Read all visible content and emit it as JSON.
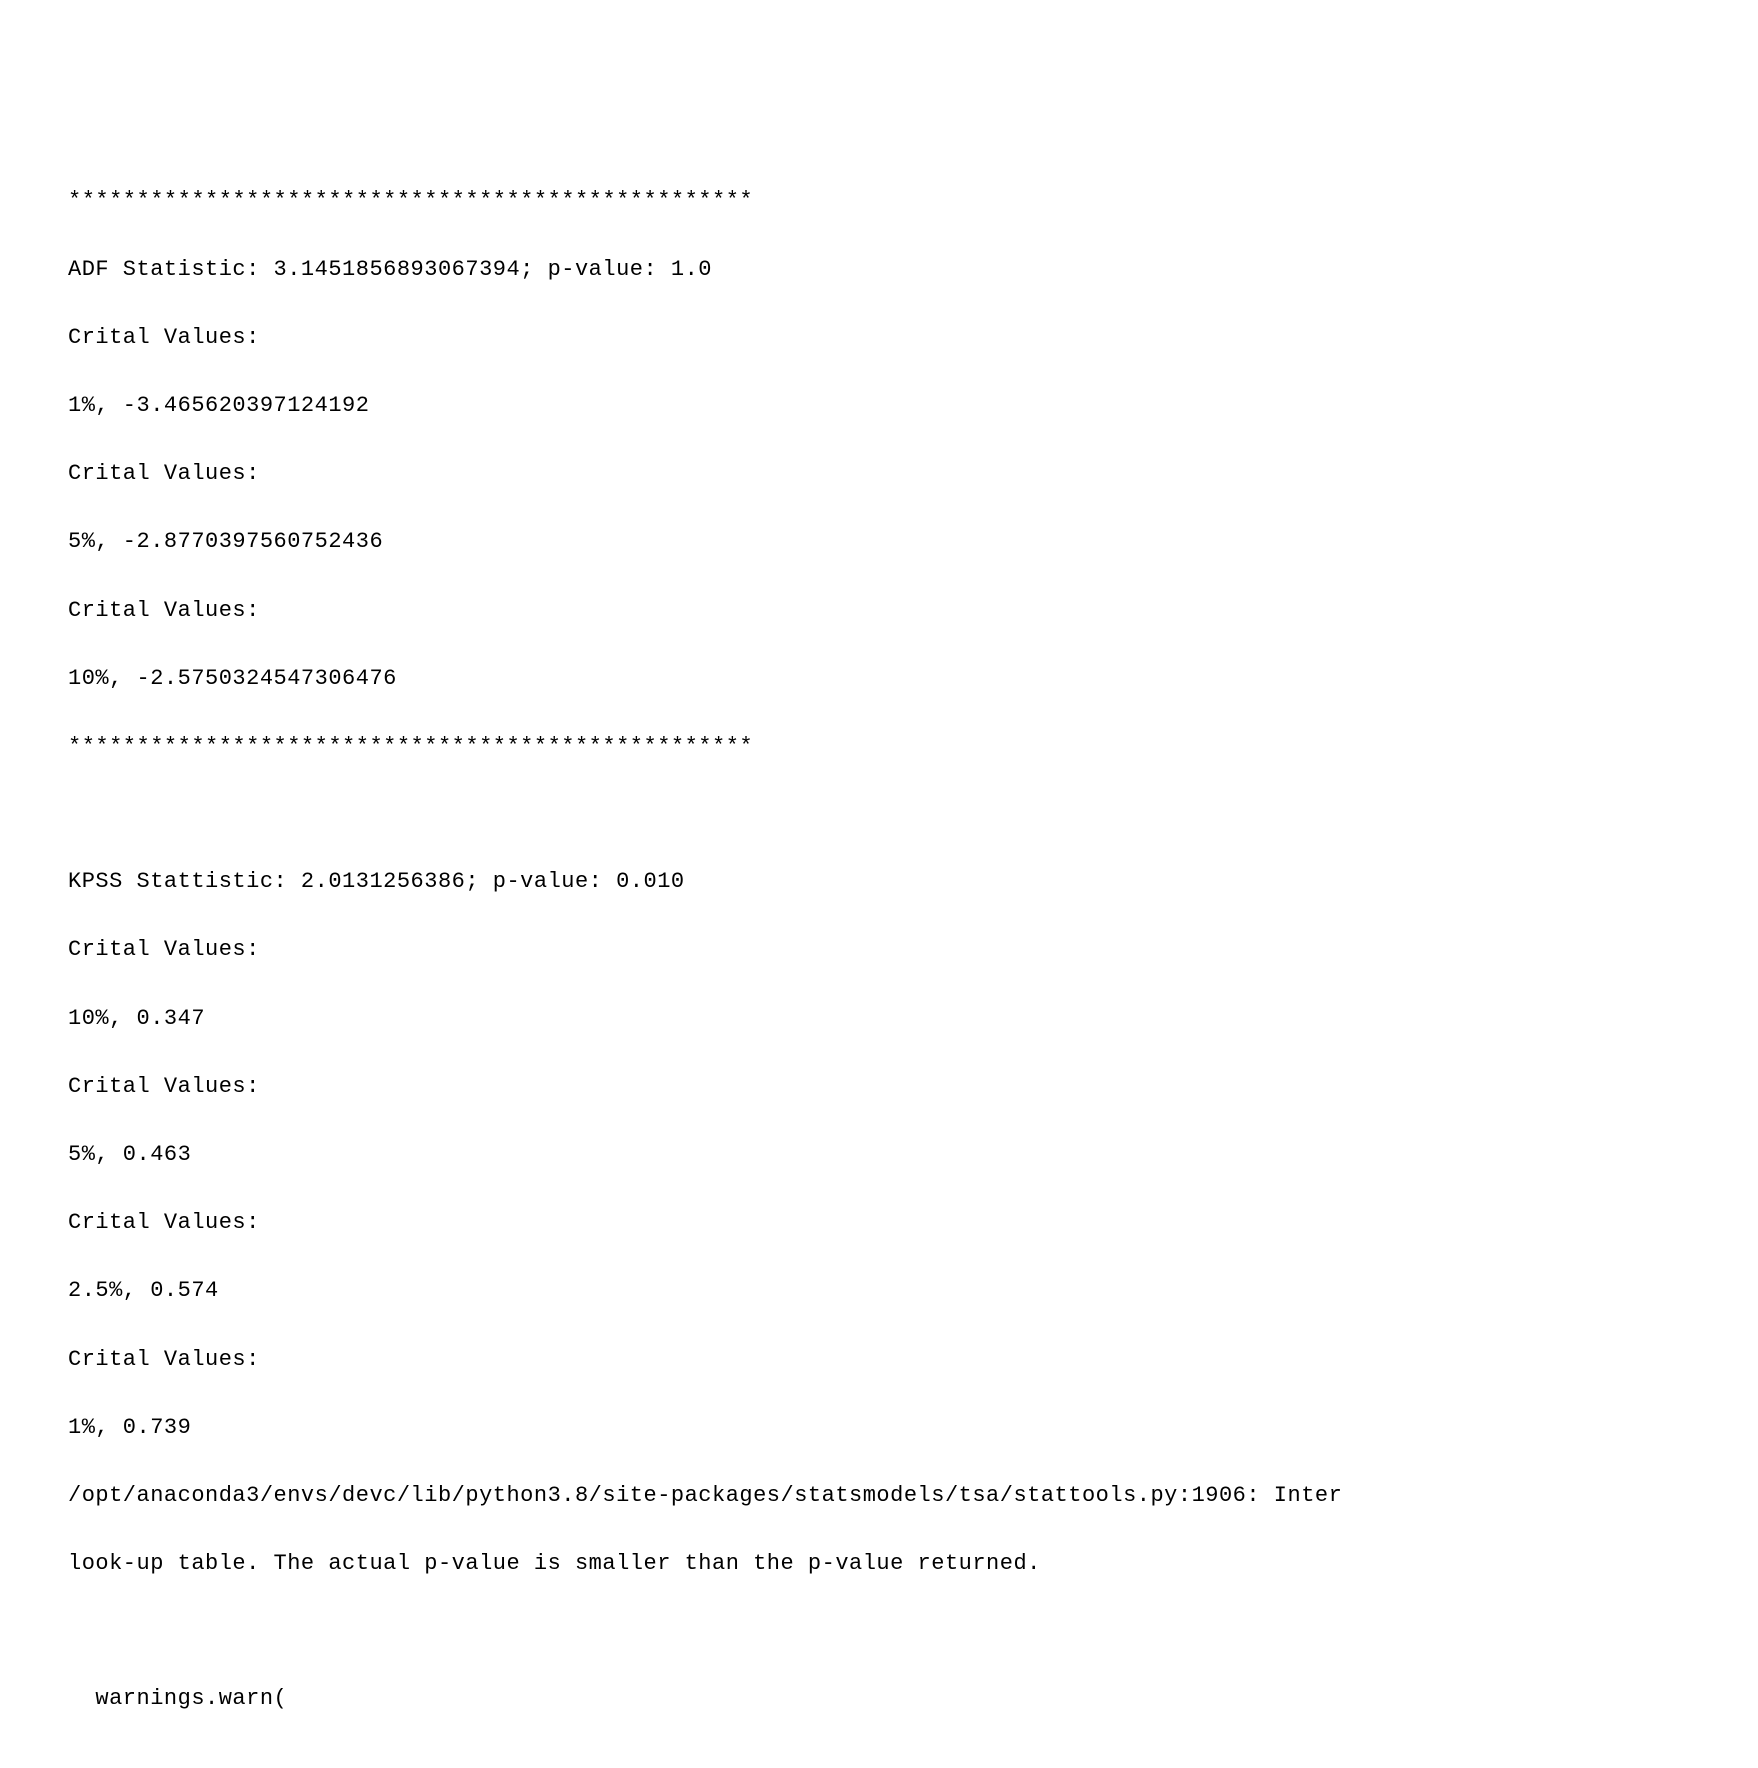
{
  "output": {
    "separator_top": "**************************************************",
    "adf": {
      "stat_line": "ADF Statistic: 3.1451856893067394; p-value: 1.0",
      "cv_label_1": "Crital Values:",
      "cv_1": "1%, -3.465620397124192",
      "cv_label_5": "Crital Values:",
      "cv_5": "5%, -2.8770397560752436",
      "cv_label_10": "Crital Values:",
      "cv_10": "10%, -2.5750324547306476"
    },
    "separator_bottom": "**************************************************",
    "kpss": {
      "stat_line": "KPSS Stattistic: 2.0131256386; p-value: 0.010",
      "cv_label_10": "Crital Values:",
      "cv_10": "10%, 0.347",
      "cv_label_5": "Crital Values:",
      "cv_5": "5%, 0.463",
      "cv_label_2_5": "Crital Values:",
      "cv_2_5": "2.5%, 0.574",
      "cv_label_1": "Crital Values:",
      "cv_1": "1%, 0.739"
    },
    "warning": {
      "line1": "/opt/anaconda3/envs/devc/lib/python3.8/site-packages/statsmodels/tsa/stattools.py:1906: Inter",
      "line2": "look-up table. The actual p-value is smaller than the p-value returned.",
      "line3": "  warnings.warn("
    }
  }
}
